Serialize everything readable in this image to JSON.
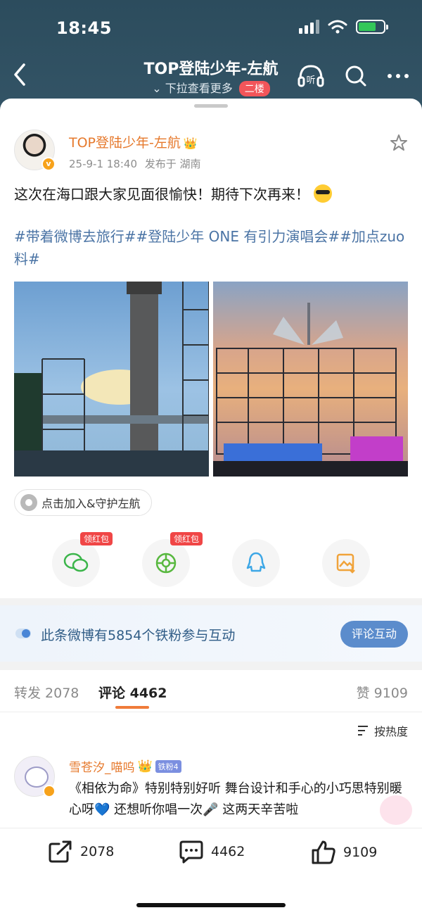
{
  "status_bar": {
    "time": "18:45"
  },
  "header": {
    "title": "TOP登陆少年-左航",
    "subtitle": "下拉查看更多",
    "floor_badge": "二楼",
    "listen_label": "听"
  },
  "post": {
    "author": "TOP登陆少年-左航",
    "date": "25-9-1 18:40",
    "published_from": "发布于 湖南",
    "text": "这次在海口跟大家见面很愉快！期待下次再来！",
    "hashtags": "#带着微博去旅行##登陆少年 ONE 有引力演唱会##加点zuo料#",
    "join_chip": "点击加入&守护左航"
  },
  "share": {
    "wechat_tag": "领红包",
    "moments_tag": "领红包"
  },
  "fans_banner": {
    "text": "此条微博有5854个铁粉参与互动",
    "button": "评论互动"
  },
  "tabs": {
    "repost": "转发 2078",
    "comments": "评论 4462",
    "likes": "赞 9109"
  },
  "sort_label": "按热度",
  "comment": {
    "author": "雪苍汐_喵呜",
    "fan_badge": "铁粉4",
    "text": "《相依为命》特别特别好听 舞台设计和手心的小巧思特别暖心呀💙 还想听你唱一次🎤 这两天辛苦啦"
  },
  "bottom_bar": {
    "repost_count": "2078",
    "comment_count": "4462",
    "like_count": "9109"
  },
  "colors": {
    "accent_orange": "#e6792c",
    "link_blue": "#4b74a5",
    "header_bg": "#2f4f60",
    "button_blue": "#5b8ccc",
    "red_badge": "#f04646"
  }
}
